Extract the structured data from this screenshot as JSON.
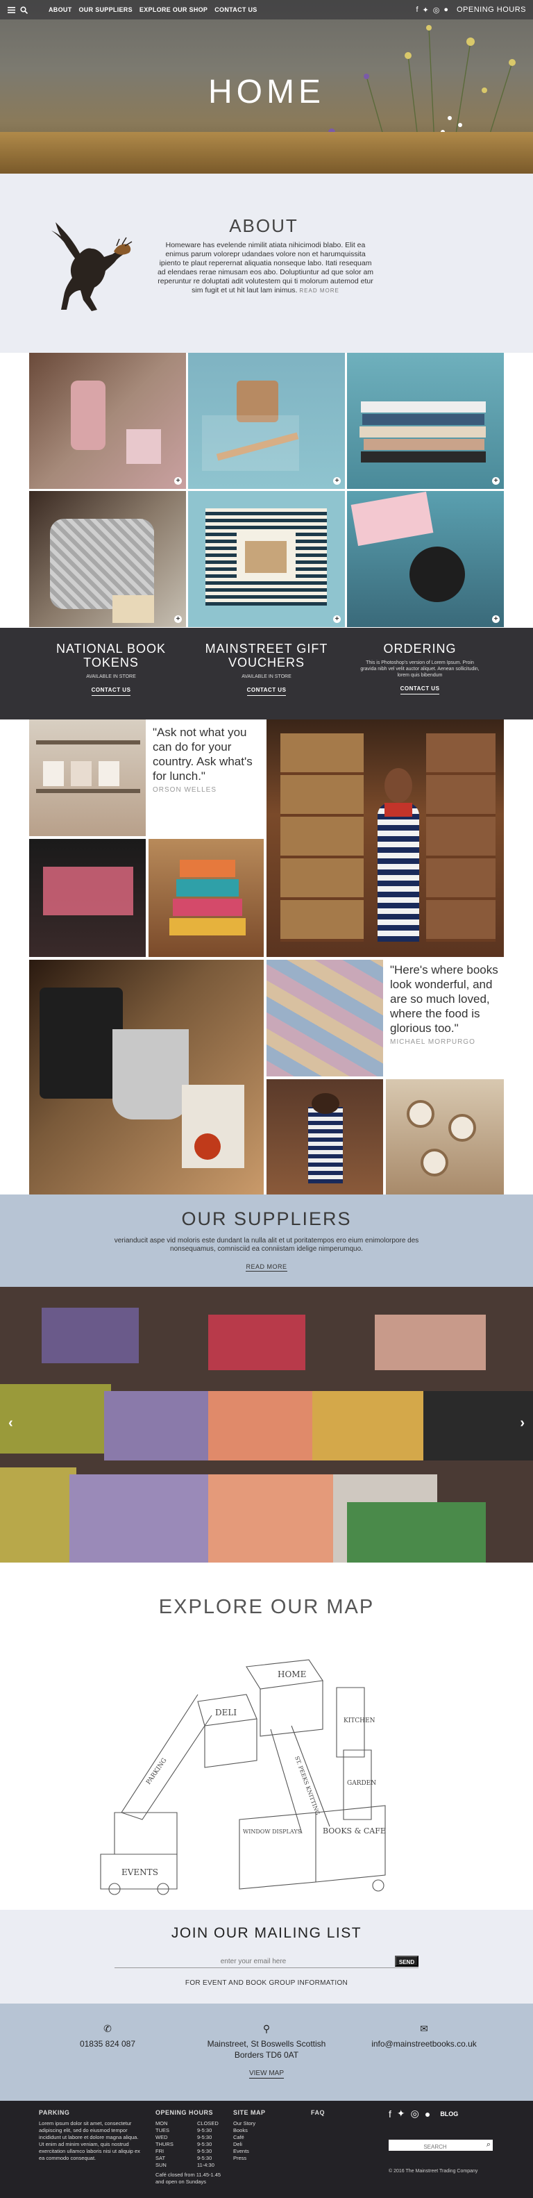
{
  "topbar": {
    "nav": [
      "ABOUT",
      "OUR SUPPLIERS",
      "EXPLORE OUR SHOP",
      "CONTACT US"
    ],
    "opening_hours": "OPENING HOURS"
  },
  "hero": {
    "title": "HOME"
  },
  "about": {
    "title": "ABOUT",
    "body": "Homeware has evelende nimilit atiata nihicimodi blabo. Elit ea enimus parum volorepr udandaes volore non et harumquissita ipiento te plaut reperernat aliquatia nonseque labo. Itati resequam ad elendaes rerae nimusam eos abo. Doluptiuntur ad que solor am reperuntur re doluptati adit volutestem qui ti molorum autemod etur sim fugit et ut hit laut lam inimus.",
    "read_more": "READ MORE"
  },
  "features": [
    {
      "title": "NATIONAL BOOK TOKENS",
      "sub": "AVAILABLE IN STORE",
      "button": "CONTACT US"
    },
    {
      "title": "MAINSTREET GIFT VOUCHERS",
      "sub": "AVAILABLE IN STORE",
      "button": "CONTACT US"
    },
    {
      "title": "ORDERING",
      "sub": "This is Photoshop's version of Lorem Ipsum. Proin gravida nibh vel velit auctor aliquet. Aenean sollicitudin, lorem quis bibendum",
      "button": "CONTACT US"
    }
  ],
  "quotes": [
    {
      "text": "\"Ask not what you can do for your country. Ask what's for lunch.\"",
      "author": "ORSON WELLES"
    },
    {
      "text": "\"Here's where books look wonderful, and are so much loved, where the food is glorious too.\"",
      "author": "MICHAEL MORPURGO"
    }
  ],
  "suppliers": {
    "title": "OUR SUPPLIERS",
    "body": "verianducit aspe vid moloris este dundant la nulla alit et ut poritatempos ero eium enimolorpore des nonsequamus, comnisciid ea conniistam idelige nimperumquo.",
    "read_more": "READ MORE"
  },
  "map": {
    "title": "EXPLORE OUR MAP",
    "labels": [
      "HOME",
      "DELI",
      "KITCHEN",
      "GARDEN",
      "BOOKS & CAFE",
      "EVENTS",
      "PARKING",
      "WINDOW DISPLAYS",
      "ST. PEEKS KNITTING"
    ]
  },
  "mailing": {
    "title": "JOIN OUR MAILING LIST",
    "placeholder": "enter your email here",
    "send": "SEND",
    "note": "FOR EVENT AND BOOK GROUP INFORMATION"
  },
  "contact": {
    "phone": "01835 824 087",
    "address": "Mainstreet, St Boswells Scottish Borders TD6 0AT",
    "email": "info@mainstreetbooks.co.uk",
    "view_map": "VIEW MAP"
  },
  "footer": {
    "parking_title": "PARKING",
    "parking_text": "Lorem ipsum dolor sit amet, consectetur adipiscing elit, sed do eiusmod tempor incididunt ut labore et dolore magna aliqua. Ut enim ad minim veniam, quis nostrud exercitation ullamco laboris nisi ut aliquip ex ea commodo consequat.",
    "hours_title": "OPENING HOURS",
    "hours": [
      {
        "day": "MON",
        "time": "CLOSED"
      },
      {
        "day": "TUES",
        "time": "9-5:30"
      },
      {
        "day": "WED",
        "time": "9-5:30"
      },
      {
        "day": "THURS",
        "time": "9-5:30"
      },
      {
        "day": "FRI",
        "time": "9-5:30"
      },
      {
        "day": "SAT",
        "time": "9-5:30"
      },
      {
        "day": "SUN",
        "time": "11-4:30"
      }
    ],
    "hours_note": "Café closed from 11.45-1.45 and open on Sundays",
    "sitemap_title": "SITE MAP",
    "sitemap": [
      "Our Story",
      "Books",
      "Café",
      "Deli",
      "Events",
      "Press"
    ],
    "faq_title": "FAQ",
    "blog": "BLOG",
    "search_placeholder": "SEARCH",
    "copyright": "© 2016 The Mainstreet Trading Company"
  }
}
